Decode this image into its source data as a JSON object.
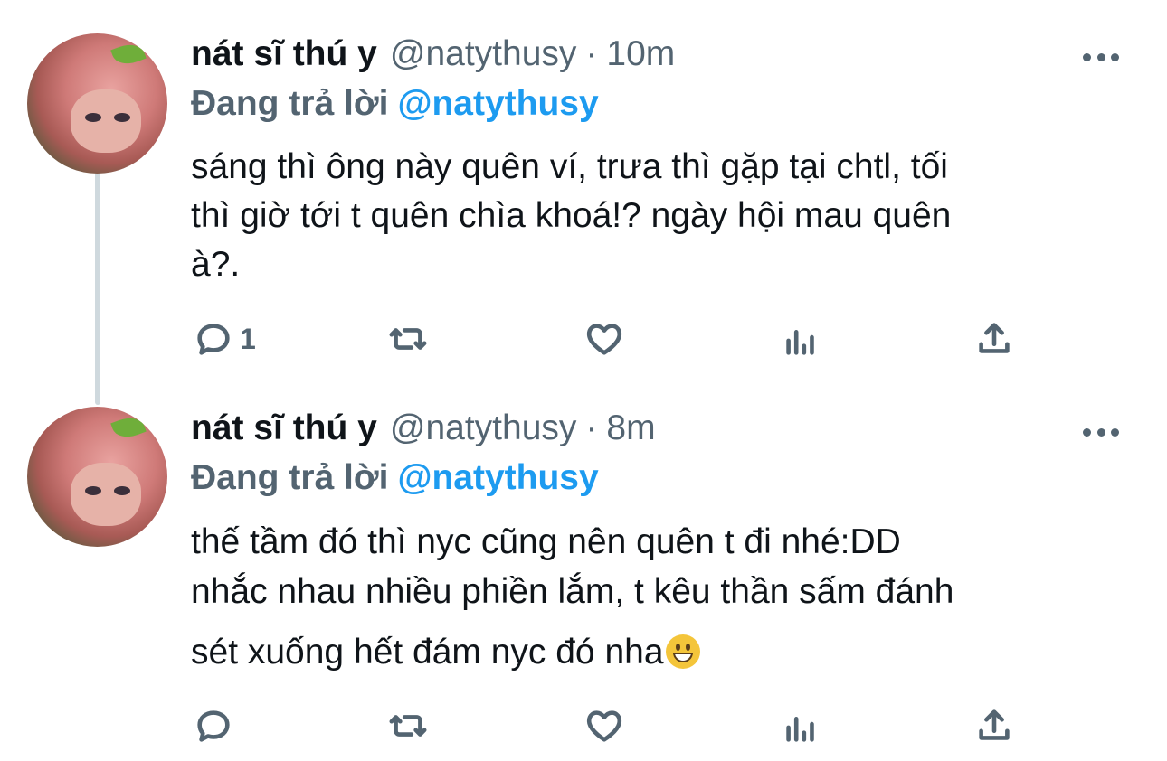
{
  "tweets": [
    {
      "display_name": "nát sĩ thú y",
      "handle": "@natythusy",
      "separator": "·",
      "time": "10m",
      "replying_label": "Đang trả lời",
      "replying_to": "@natythusy",
      "text_lines": [
        "sáng thì ông này quên ví, trưa thì gặp tại chtl, tối",
        "thì giờ tới t quên chìa khoá!? ngày hội mau quên",
        "à?."
      ],
      "reply_count": "1"
    },
    {
      "display_name": "nát sĩ thú y",
      "handle": "@natythusy",
      "separator": "·",
      "time": "8m",
      "replying_label": "Đang trả lời",
      "replying_to": "@natythusy",
      "text_lines": [
        "thế tầm đó thì nyc cũng nên quên t đi nhé:DD",
        "nhắc nhau nhiều phiền lắm, t kêu thần sấm đánh",
        "sét xuống hết đám nyc đó nha"
      ],
      "emoji": "grinning-face-emoji",
      "reply_count": ""
    }
  ],
  "icons": {
    "reply": "reply-icon",
    "retweet": "retweet-icon",
    "like": "heart-icon",
    "views": "views-icon",
    "share": "share-icon",
    "more": "more-icon"
  },
  "colors": {
    "text": "#0f1419",
    "secondary": "#536471",
    "accent": "#1d9bf0",
    "thread_line": "#cfd9de"
  }
}
